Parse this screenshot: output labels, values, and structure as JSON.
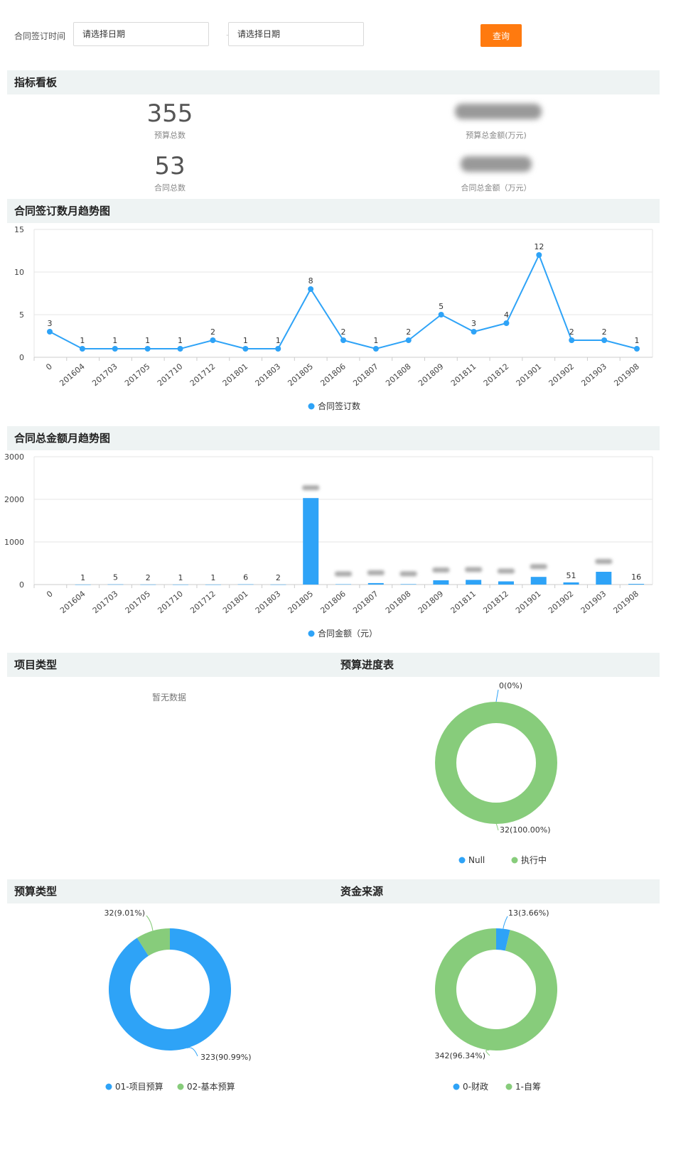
{
  "filter": {
    "label": "合同签订时间",
    "start_placeholder": "请选择日期",
    "end_placeholder": "请选择日期",
    "separator": "–",
    "query_label": "查询"
  },
  "sections": {
    "dashboard": "指标看板",
    "count_trend": "合同签订数月趋势图",
    "amount_trend": "合同总金额月趋势图",
    "project_type": "项目类型",
    "budget_progress": "预算进度表",
    "budget_type": "预算类型",
    "fund_source": "资金来源"
  },
  "kpis": [
    {
      "value": "355",
      "caption": "预算总数"
    },
    {
      "value": "",
      "caption": "预算总金额(万元)"
    },
    {
      "value": "53",
      "caption": "合同总数"
    },
    {
      "value": "",
      "caption": "合同总金额（万元）"
    }
  ],
  "no_data": "暂无数据",
  "colors": {
    "blue": "#2ea3f7",
    "green": "#87cc7b",
    "orange": "#ff7a0f"
  },
  "chart_data": [
    {
      "type": "line",
      "categories": [
        "0",
        "201604",
        "201703",
        "201705",
        "201710",
        "201712",
        "201801",
        "201803",
        "201805",
        "201806",
        "201807",
        "201808",
        "201809",
        "201811",
        "201812",
        "201901",
        "201902",
        "201903",
        "201908"
      ],
      "series": [
        {
          "name": "合同签订数",
          "values": [
            3,
            1,
            1,
            1,
            1,
            2,
            1,
            1,
            8,
            2,
            1,
            2,
            5,
            3,
            4,
            12,
            2,
            2,
            1
          ]
        }
      ],
      "yticks": [
        "0",
        "5",
        "10",
        "15"
      ],
      "ylim": [
        0,
        15
      ],
      "grid": true,
      "legend": "bottom"
    },
    {
      "type": "bar",
      "categories": [
        "0",
        "201604",
        "201703",
        "201705",
        "201710",
        "201712",
        "201801",
        "201803",
        "201805",
        "201806",
        "201807",
        "201808",
        "201809",
        "201811",
        "201812",
        "201901",
        "201902",
        "201903",
        "201908"
      ],
      "series": [
        {
          "name": "合同金额（元）",
          "values": [
            0,
            1,
            5,
            2,
            1,
            1,
            6,
            2,
            2030,
            8,
            35,
            10,
            100,
            110,
            75,
            180,
            51,
            300,
            16
          ]
        }
      ],
      "data_labels": [
        "",
        "1",
        "5",
        "2",
        "1",
        "1",
        "6",
        "2",
        "",
        "",
        "",
        "",
        "",
        "",
        "",
        "",
        "51",
        "",
        "16"
      ],
      "yticks": [
        "0",
        "1000",
        "2000",
        "3000"
      ],
      "ylim": [
        0,
        3000
      ],
      "grid": true,
      "legend": "bottom"
    },
    {
      "type": "pie",
      "title": "预算进度表",
      "slices": [
        {
          "name": "Null",
          "value": 0,
          "label": "0(0%)",
          "color": "#2ea3f7"
        },
        {
          "name": "执行中",
          "value": 32,
          "label": "32(100.00%)",
          "color": "#87cc7b"
        }
      ],
      "legend": "bottom"
    },
    {
      "type": "pie",
      "title": "预算类型",
      "slices": [
        {
          "name": "01-项目预算",
          "value": 323,
          "label": "323(90.99%)",
          "color": "#2ea3f7"
        },
        {
          "name": "02-基本预算",
          "value": 32,
          "label": "32(9.01%)",
          "color": "#87cc7b"
        }
      ],
      "legend": "bottom"
    },
    {
      "type": "pie",
      "title": "资金来源",
      "slices": [
        {
          "name": "0-财政",
          "value": 13,
          "label": "13(3.66%)",
          "color": "#2ea3f7"
        },
        {
          "name": "1-自筹",
          "value": 342,
          "label": "342(96.34%)",
          "color": "#87cc7b"
        }
      ],
      "legend": "bottom"
    }
  ]
}
